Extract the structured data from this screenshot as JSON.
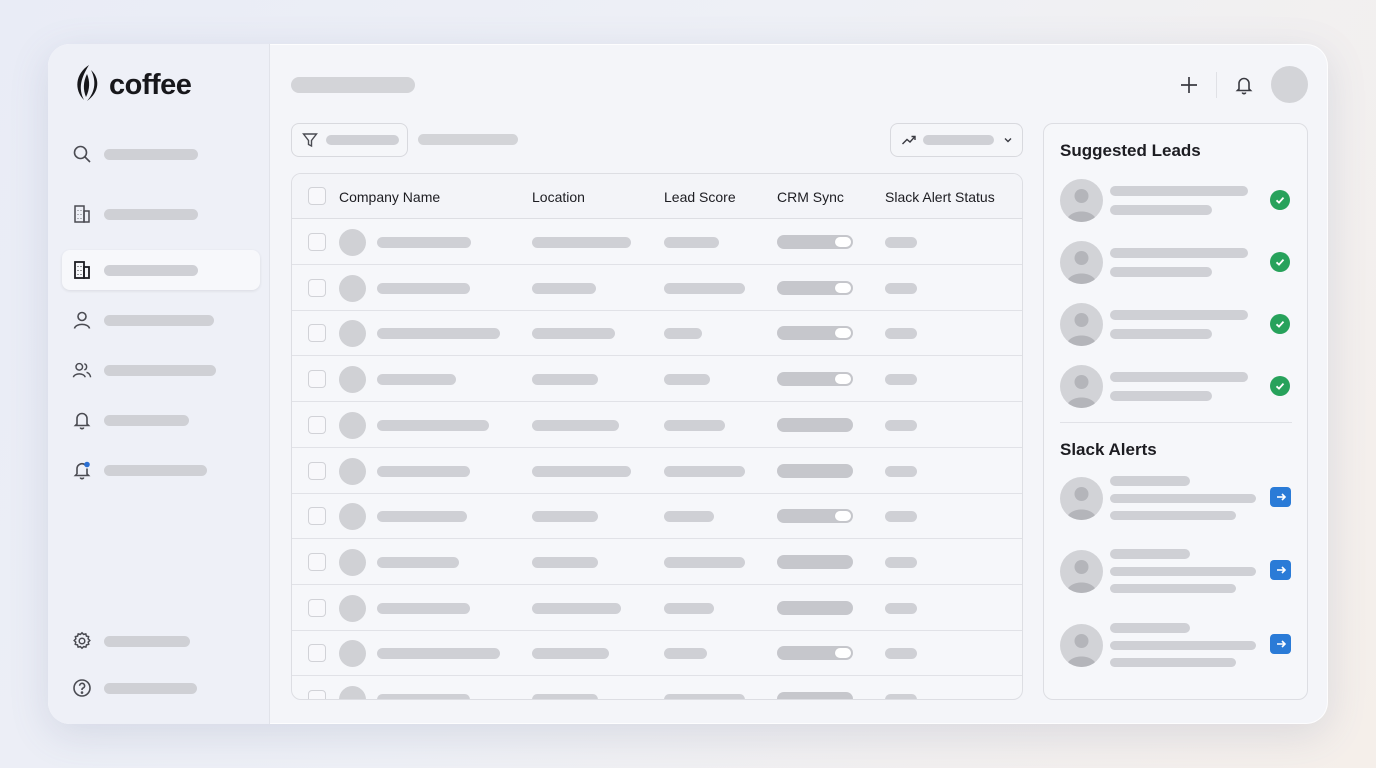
{
  "app": {
    "logo_text": "coffee"
  },
  "sidebar": {
    "items": [
      {
        "icon": "search-icon"
      },
      {
        "icon": "building-icon"
      },
      {
        "icon": "building-icon",
        "active": true
      },
      {
        "icon": "user-icon"
      },
      {
        "icon": "users-icon"
      },
      {
        "icon": "bell-icon"
      },
      {
        "icon": "bell-dot-icon"
      }
    ],
    "footer": [
      {
        "icon": "gear-icon"
      },
      {
        "icon": "help-icon"
      }
    ]
  },
  "header": {
    "actions": [
      "plus-icon",
      "bell-icon",
      "avatar"
    ]
  },
  "toolbar": {
    "filter_icon": "filter-icon",
    "sort_icon": "trend-icon"
  },
  "table": {
    "columns": [
      "Company Name",
      "Location",
      "Lead Score",
      "CRM Sync",
      "Slack Alert Status"
    ],
    "crm_sync_enabled": [
      true,
      true,
      true,
      true,
      false,
      false,
      true,
      false,
      false,
      true,
      false
    ]
  },
  "right_panel": {
    "suggested_title": "Suggested Leads",
    "alerts_title": "Slack Alerts",
    "accent": {
      "check": "#27a25b",
      "link": "#2a7bd7"
    }
  }
}
